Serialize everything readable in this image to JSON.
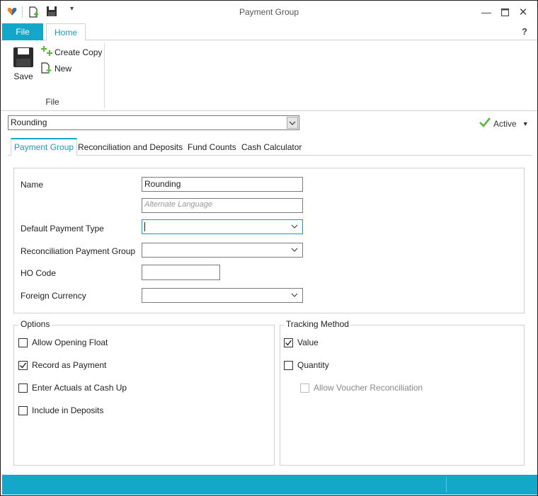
{
  "window": {
    "title": "Payment Group"
  },
  "ribbon": {
    "tabs": [
      {
        "label": "File"
      },
      {
        "label": "Home"
      }
    ],
    "help_label": "?",
    "file_group": {
      "label": "File",
      "save_label": "Save",
      "create_copy_label": "Create Copy",
      "new_label": "New"
    }
  },
  "record": {
    "selected": "Rounding"
  },
  "status": {
    "label": "Active"
  },
  "content_tabs": [
    {
      "label": "Payment Group"
    },
    {
      "label": "Reconciliation and Deposits"
    },
    {
      "label": "Fund Counts"
    },
    {
      "label": "Cash Calculator"
    }
  ],
  "form": {
    "name_label": "Name",
    "name_value": "Rounding",
    "alt_language_placeholder": "Alternate Language",
    "default_payment_type_label": "Default Payment Type",
    "default_payment_type_value": "",
    "reconciliation_payment_group_label": "Reconciliation Payment Group",
    "reconciliation_payment_group_value": "",
    "ho_code_label": "HO Code",
    "ho_code_value": "",
    "foreign_currency_label": "Foreign Currency",
    "foreign_currency_value": ""
  },
  "options": {
    "title": "Options",
    "items": [
      {
        "label": "Allow Opening Float",
        "checked": false
      },
      {
        "label": "Record as Payment",
        "checked": true
      },
      {
        "label": "Enter Actuals at Cash Up",
        "checked": false
      },
      {
        "label": "Include in Deposits",
        "checked": false
      }
    ]
  },
  "tracking": {
    "title": "Tracking Method",
    "items": [
      {
        "label": "Value",
        "checked": true
      },
      {
        "label": "Quantity",
        "checked": false
      },
      {
        "label": "Allow Voucher Reconciliation",
        "checked": false,
        "disabled": true
      }
    ]
  },
  "colors": {
    "accent": "#13a8c9",
    "check_green": "#5bb53a"
  }
}
